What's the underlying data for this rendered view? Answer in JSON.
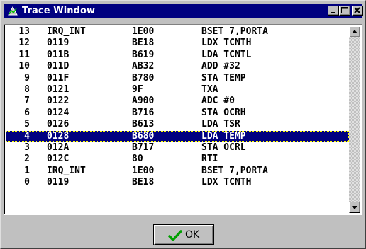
{
  "window": {
    "title": "Trace Window",
    "icon": "trace-app-icon"
  },
  "titlebar_buttons": {
    "minimize_icon": "minimize-icon",
    "maximize_icon": "maximize-icon",
    "close_icon": "close-icon"
  },
  "trace": {
    "selected_index": 9,
    "rows": [
      {
        "idx": "13",
        "addr": "IRQ_INT",
        "code": "1E00",
        "instr": "BSET 7,PORTA"
      },
      {
        "idx": "12",
        "addr": "0119",
        "code": "BE18",
        "instr": "LDX TCNTH"
      },
      {
        "idx": "11",
        "addr": "011B",
        "code": "B619",
        "instr": "LDA TCNTL"
      },
      {
        "idx": "10",
        "addr": "011D",
        "code": "AB32",
        "instr": "ADD #32"
      },
      {
        "idx": "9",
        "addr": "011F",
        "code": "B780",
        "instr": "STA TEMP"
      },
      {
        "idx": "8",
        "addr": "0121",
        "code": "9F",
        "instr": "TXA"
      },
      {
        "idx": "7",
        "addr": "0122",
        "code": "A900",
        "instr": "ADC #0"
      },
      {
        "idx": "6",
        "addr": "0124",
        "code": "B716",
        "instr": "STA OCRH"
      },
      {
        "idx": "5",
        "addr": "0126",
        "code": "B613",
        "instr": "LDA TSR"
      },
      {
        "idx": "4",
        "addr": "0128",
        "code": "B680",
        "instr": "LDA TEMP"
      },
      {
        "idx": "3",
        "addr": "012A",
        "code": "B717",
        "instr": "STA OCRL"
      },
      {
        "idx": "2",
        "addr": "012C",
        "code": "80",
        "instr": "RTI"
      },
      {
        "idx": "1",
        "addr": "IRQ_INT",
        "code": "1E00",
        "instr": "BSET 7,PORTA"
      },
      {
        "idx": "0",
        "addr": "0119",
        "code": "BE18",
        "instr": "LDX TCNTH"
      }
    ]
  },
  "ok_button": {
    "label": "OK",
    "icon": "checkmark-icon"
  },
  "colors": {
    "titlebar": "#000080",
    "selection": "#000080",
    "face": "#c0c0c0",
    "checkmark": "#00a000"
  }
}
